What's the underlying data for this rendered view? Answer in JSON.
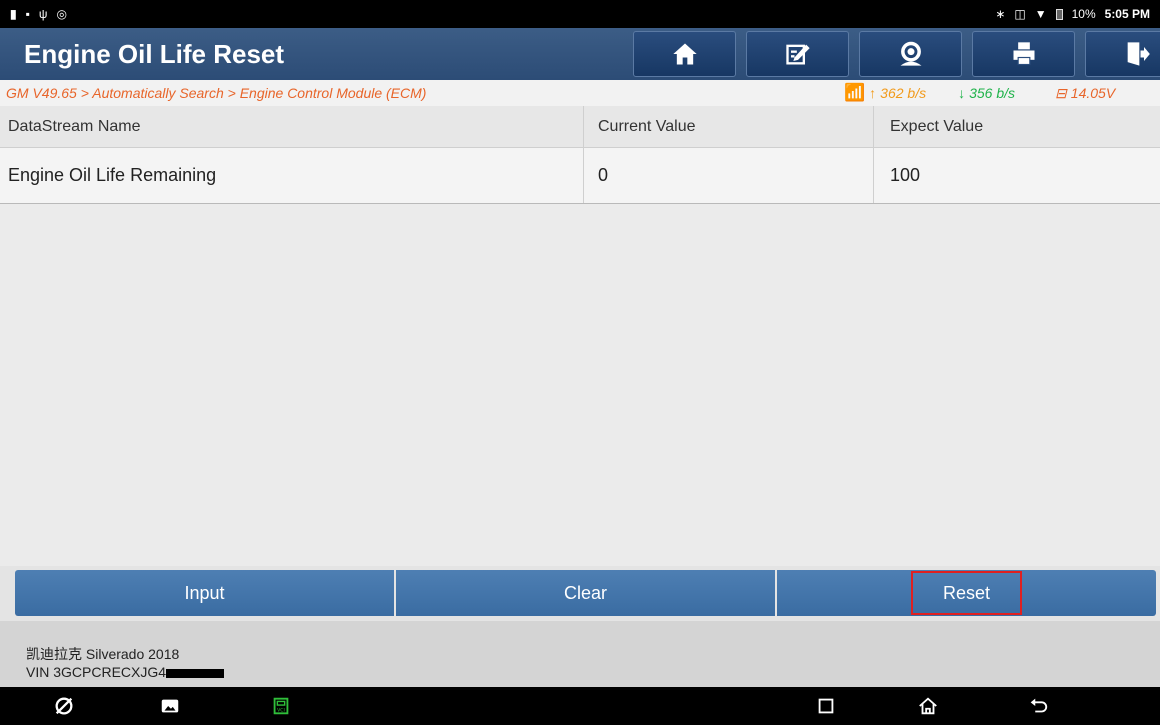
{
  "status_bar": {
    "left_icons": [
      "battery-saver-icon",
      "image-icon",
      "usb-icon",
      "nfc-icon"
    ],
    "right_icons": [
      "bluetooth-icon",
      "vibrate-icon",
      "wifi-signal-icon",
      "battery-icon"
    ],
    "battery_text": "10%",
    "time": "5:05 PM"
  },
  "header": {
    "title": "Engine Oil Life Reset",
    "buttons": [
      "home-icon",
      "edit-icon",
      "support-icon",
      "print-icon",
      "exit-icon"
    ]
  },
  "breadcrumb": {
    "path": "GM V49.65 > Automatically Search > Engine Control Module (ECM)",
    "upload": "362 b/s",
    "download": "356 b/s",
    "voltage": "14.05V"
  },
  "table": {
    "columns": [
      "DataStream Name",
      "Current Value",
      "Expect Value"
    ],
    "rows": [
      {
        "name": "Engine Oil Life Remaining",
        "current": "0",
        "expected": "100"
      }
    ]
  },
  "actions": {
    "input": "Input",
    "clear": "Clear",
    "reset": "Reset"
  },
  "vehicle": {
    "model": "凯迪拉克 Silverado 2018",
    "vin": "VIN 3GCPCRECXJG4"
  },
  "colors": {
    "title_bar": "#2c4c76",
    "breadcrumb_text": "#e8652a",
    "button_blue": "#4477aa",
    "highlight_red": "#e02020"
  }
}
